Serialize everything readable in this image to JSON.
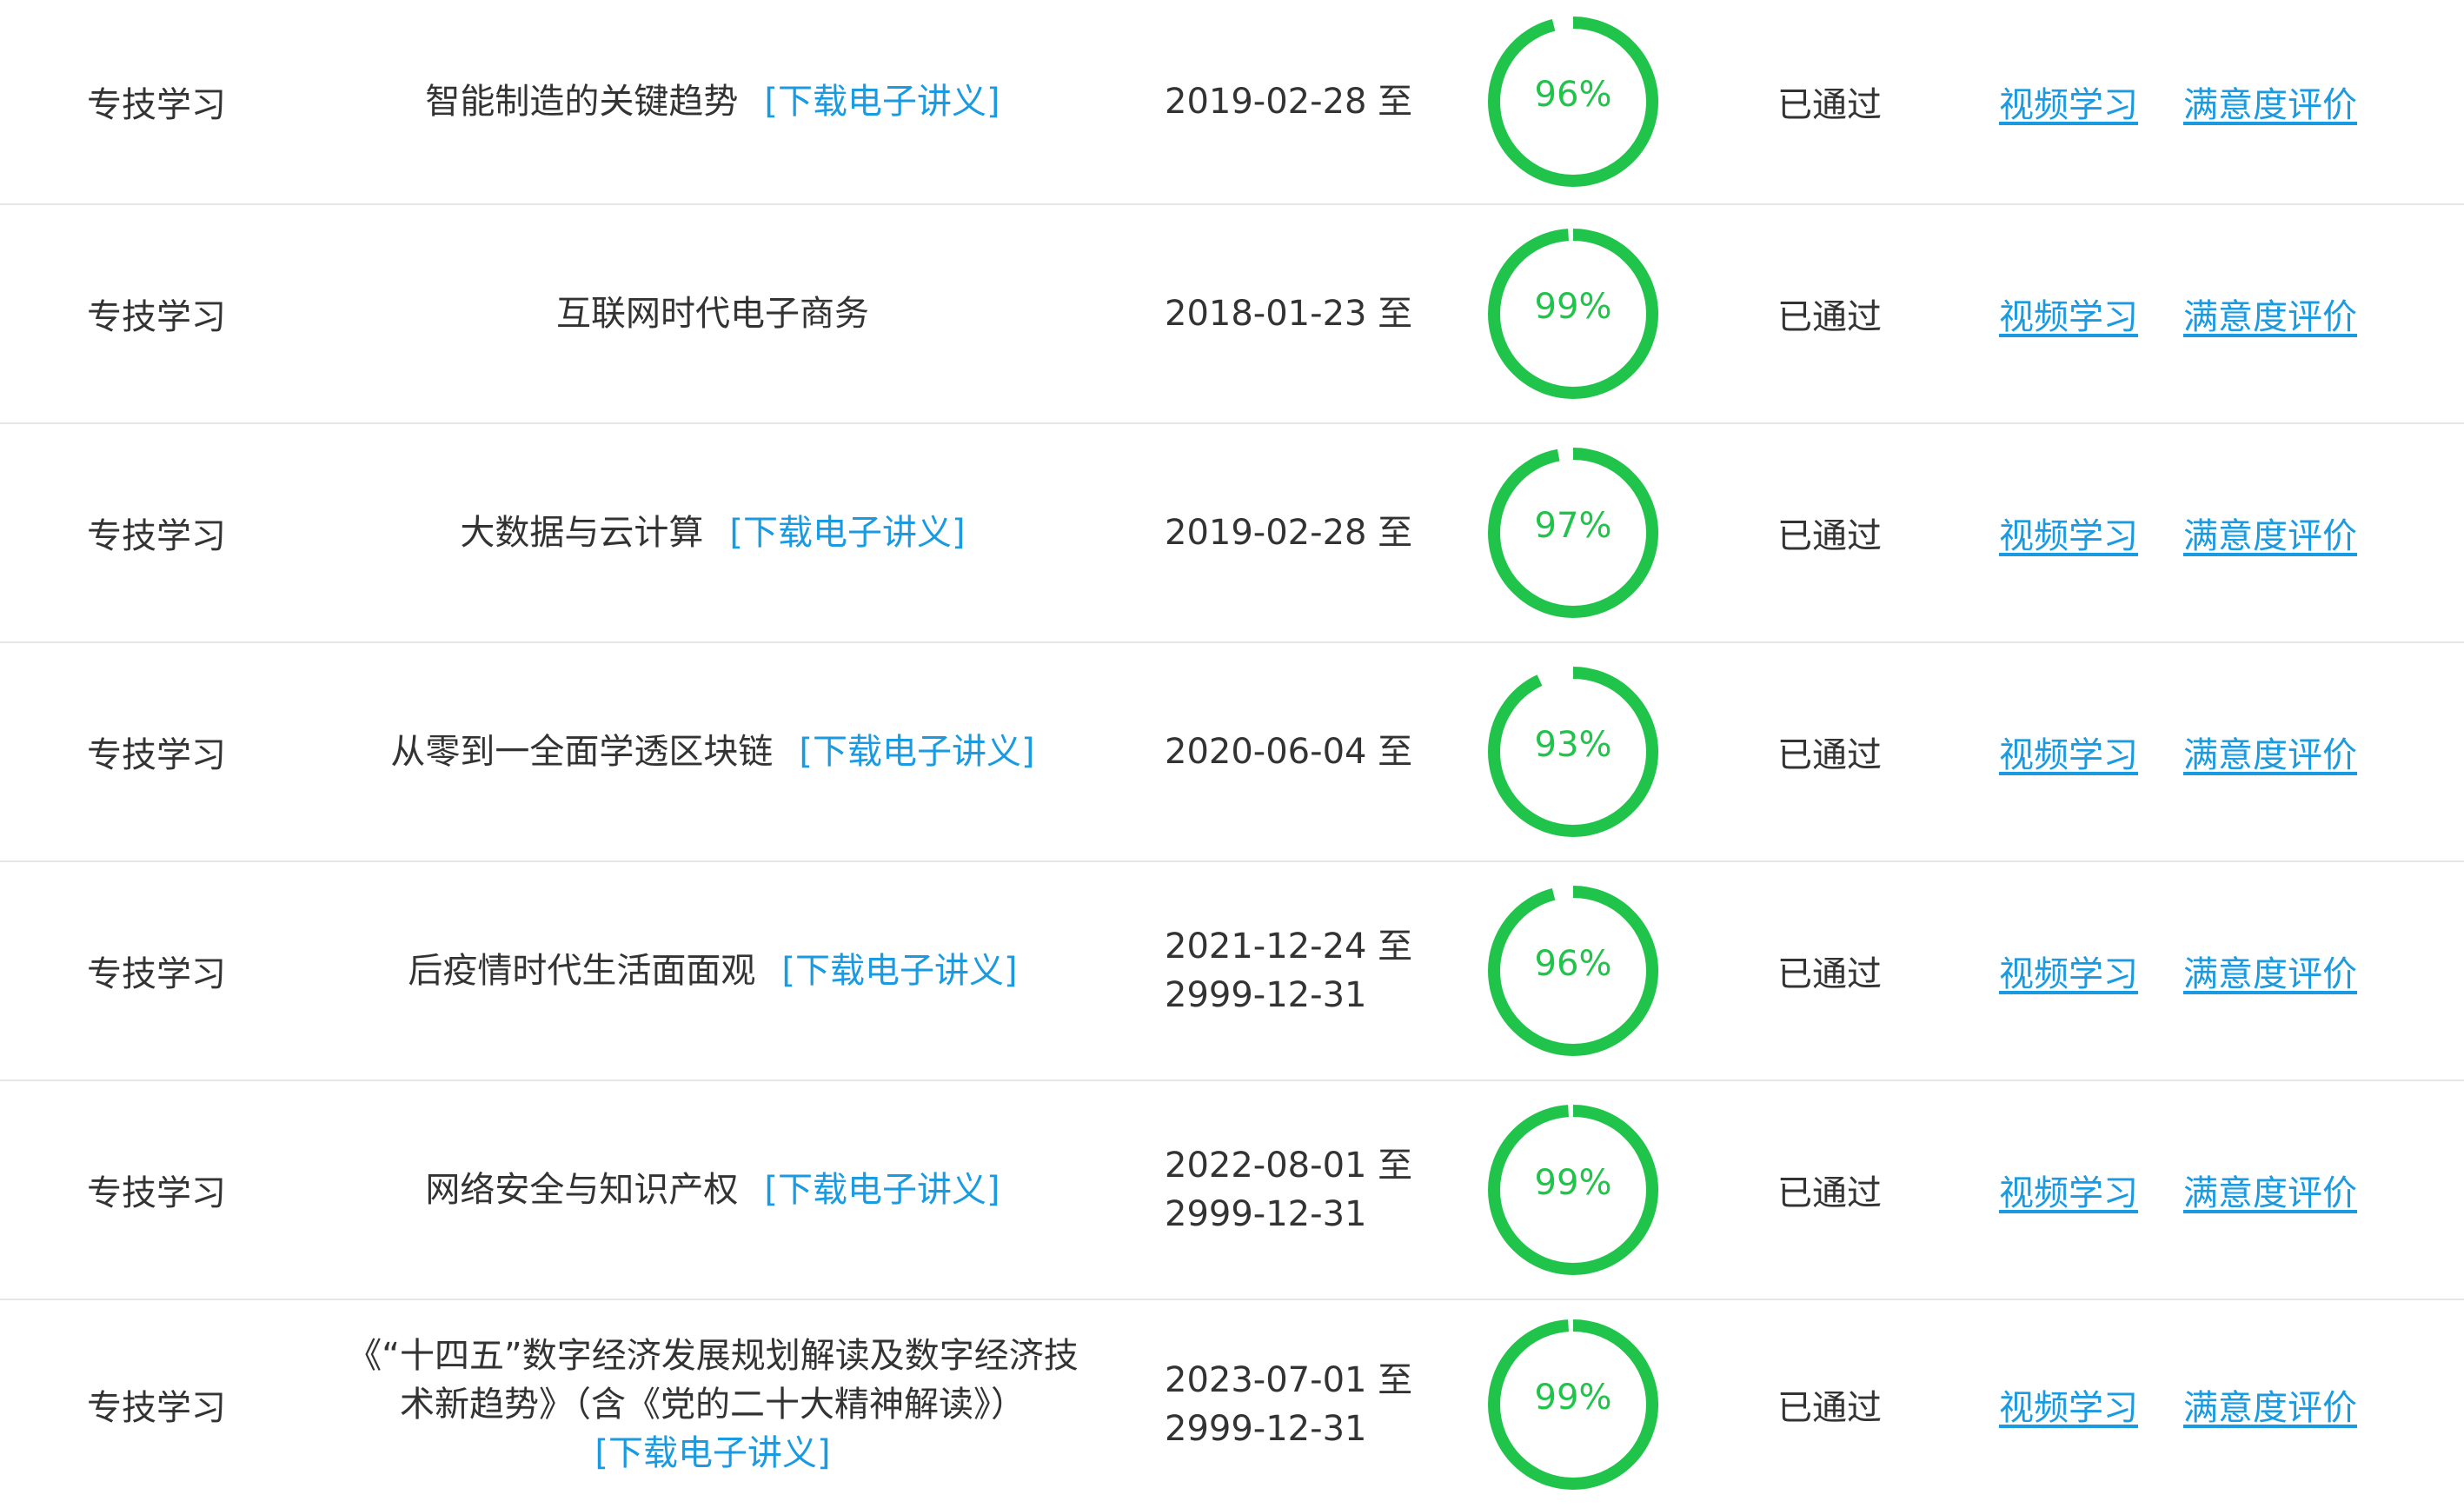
{
  "colors": {
    "progress_ring": "#21c44a",
    "link": "#1a9ae0",
    "divider": "#e6e6e6",
    "text": "#333333"
  },
  "download_label": "[下载电子讲义]",
  "rows": [
    {
      "type": "专技学习",
      "title": "智能制造的关键趋势",
      "has_download": true,
      "date_start": "2019-02-28 至",
      "date_end": "",
      "progress_text": "96%",
      "progress": 0.96,
      "status": "已通过",
      "action_video": "视频学习",
      "action_eval": "满意度评价"
    },
    {
      "type": "专技学习",
      "title": "互联网时代电子商务",
      "has_download": false,
      "date_start": "2018-01-23 至",
      "date_end": "",
      "progress_text": "99%",
      "progress": 0.99,
      "status": "已通过",
      "action_video": "视频学习",
      "action_eval": "满意度评价"
    },
    {
      "type": "专技学习",
      "title": "大数据与云计算",
      "has_download": true,
      "date_start": "2019-02-28 至",
      "date_end": "",
      "progress_text": "97%",
      "progress": 0.97,
      "status": "已通过",
      "action_video": "视频学习",
      "action_eval": "满意度评价"
    },
    {
      "type": "专技学习",
      "title": "从零到一全面学透区块链",
      "has_download": true,
      "date_start": "2020-06-04 至",
      "date_end": "",
      "progress_text": "93%",
      "progress": 0.93,
      "status": "已通过",
      "action_video": "视频学习",
      "action_eval": "满意度评价"
    },
    {
      "type": "专技学习",
      "title": "后疫情时代生活面面观",
      "has_download": true,
      "date_start": "2021-12-24 至",
      "date_end": "2999-12-31",
      "progress_text": "96%",
      "progress": 0.96,
      "status": "已通过",
      "action_video": "视频学习",
      "action_eval": "满意度评价"
    },
    {
      "type": "专技学习",
      "title": "网络安全与知识产权",
      "has_download": true,
      "date_start": "2022-08-01 至",
      "date_end": "2999-12-31",
      "progress_text": "99%",
      "progress": 0.99,
      "status": "已通过",
      "action_video": "视频学习",
      "action_eval": "满意度评价"
    },
    {
      "type": "专技学习",
      "title": "《“十四五”数字经济发展规划解读及数字经济技术新趋势》（含《党的二十大精神解读》）",
      "has_download": true,
      "download_on_new_line": true,
      "date_start": "2023-07-01 至",
      "date_end": "2999-12-31",
      "progress_text": "99%",
      "progress": 0.99,
      "status": "已通过",
      "action_video": "视频学习",
      "action_eval": "满意度评价"
    }
  ]
}
